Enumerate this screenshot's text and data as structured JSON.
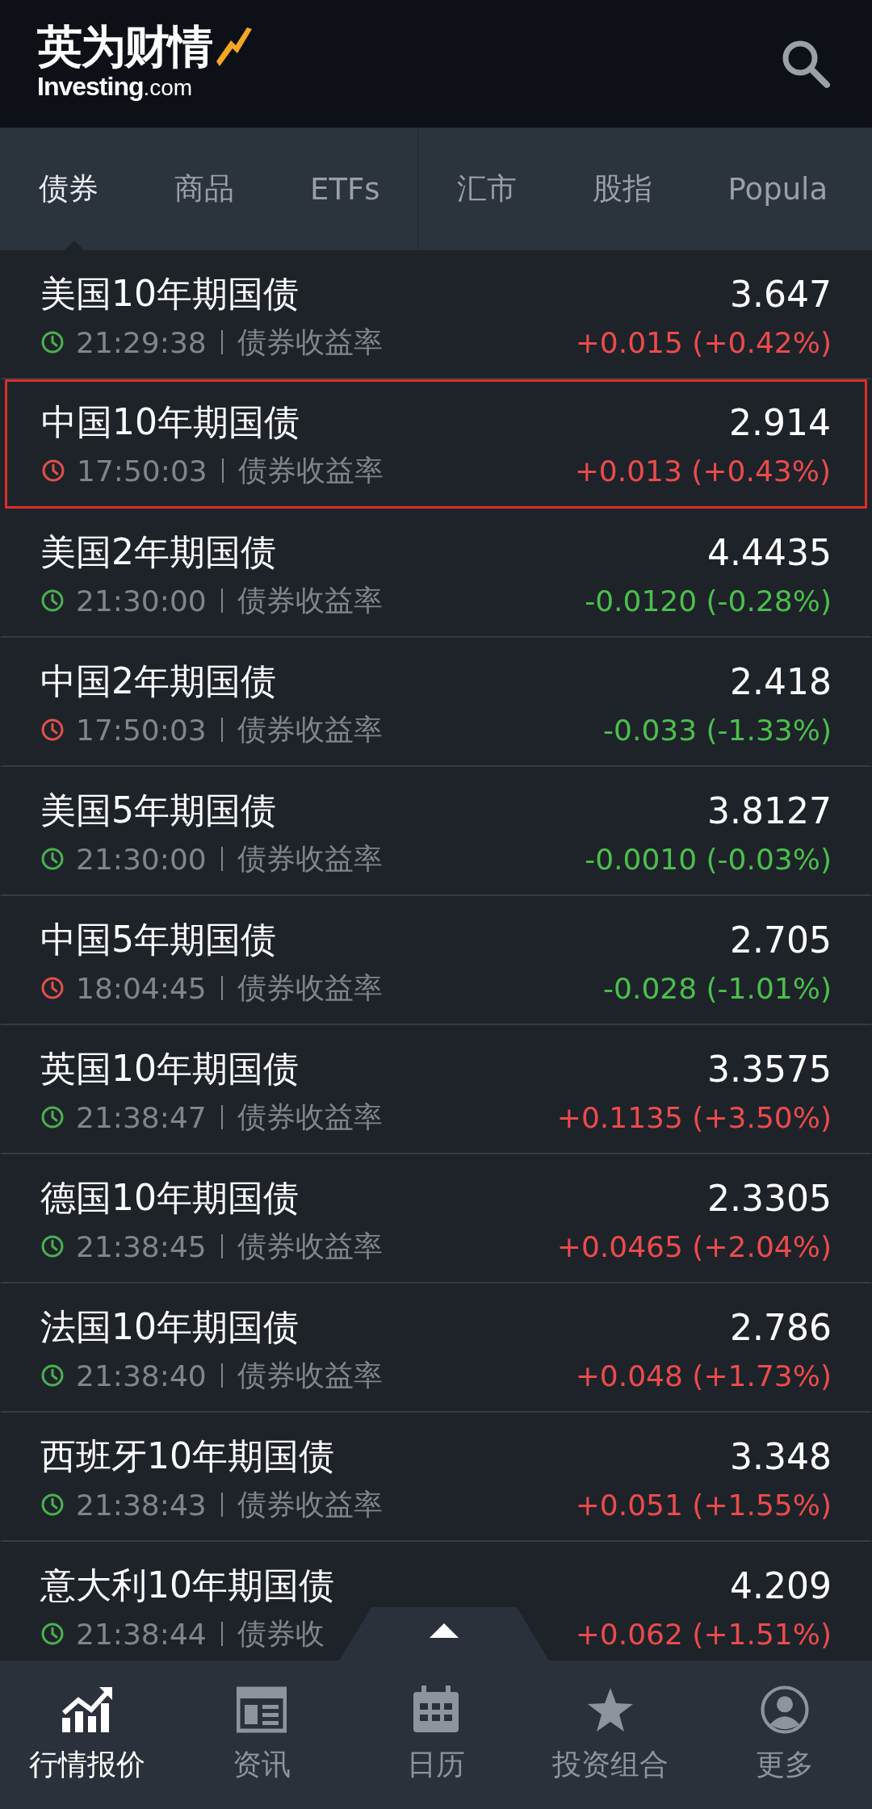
{
  "header": {
    "logo_title": "英为财情",
    "logo_brand": "Investing",
    "logo_suffix": ".com"
  },
  "tabs": [
    {
      "label": "债券",
      "selected": true
    },
    {
      "label": "商品",
      "selected": false
    },
    {
      "label": "ETFs",
      "selected": false
    },
    {
      "label": "汇市",
      "selected": false
    },
    {
      "label": "股指",
      "selected": false
    },
    {
      "label": "Popula",
      "selected": false
    }
  ],
  "rows": [
    {
      "name": "美国10年期国债",
      "time": "21:29:38",
      "type": "债券收益率",
      "price": "3.647",
      "change": "+0.015 (+0.42%)",
      "rising": true,
      "market_open": true,
      "highlighted": false
    },
    {
      "name": "中国10年期国债",
      "time": "17:50:03",
      "type": "债券收益率",
      "price": "2.914",
      "change": "+0.013 (+0.43%)",
      "rising": true,
      "market_open": false,
      "highlighted": true
    },
    {
      "name": "美国2年期国债",
      "time": "21:30:00",
      "type": "债券收益率",
      "price": "4.4435",
      "change": "-0.0120 (-0.28%)",
      "rising": false,
      "market_open": true,
      "highlighted": false
    },
    {
      "name": "中国2年期国债",
      "time": "17:50:03",
      "type": "债券收益率",
      "price": "2.418",
      "change": "-0.033 (-1.33%)",
      "rising": false,
      "market_open": false,
      "highlighted": false
    },
    {
      "name": "美国5年期国债",
      "time": "21:30:00",
      "type": "债券收益率",
      "price": "3.8127",
      "change": "-0.0010 (-0.03%)",
      "rising": false,
      "market_open": true,
      "highlighted": false
    },
    {
      "name": "中国5年期国债",
      "time": "18:04:45",
      "type": "债券收益率",
      "price": "2.705",
      "change": "-0.028 (-1.01%)",
      "rising": false,
      "market_open": false,
      "highlighted": false
    },
    {
      "name": "英国10年期国债",
      "time": "21:38:47",
      "type": "债券收益率",
      "price": "3.3575",
      "change": "+0.1135 (+3.50%)",
      "rising": true,
      "market_open": true,
      "highlighted": false
    },
    {
      "name": "德国10年期国债",
      "time": "21:38:45",
      "type": "债券收益率",
      "price": "2.3305",
      "change": "+0.0465 (+2.04%)",
      "rising": true,
      "market_open": true,
      "highlighted": false
    },
    {
      "name": "法国10年期国债",
      "time": "21:38:40",
      "type": "债券收益率",
      "price": "2.786",
      "change": "+0.048 (+1.73%)",
      "rising": true,
      "market_open": true,
      "highlighted": false
    },
    {
      "name": "西班牙10年期国债",
      "time": "21:38:43",
      "type": "债券收益率",
      "price": "3.348",
      "change": "+0.051 (+1.55%)",
      "rising": true,
      "market_open": true,
      "highlighted": false
    },
    {
      "name": "意大利10年期国债",
      "time": "21:38:44",
      "type": "债券收",
      "price": "4.209",
      "change": "+0.062 (+1.51%)",
      "rising": true,
      "market_open": true,
      "highlighted": false
    }
  ],
  "bottom_nav": [
    {
      "label": "行情报价",
      "kind": "quotes",
      "selected": true
    },
    {
      "label": "资讯",
      "kind": "news",
      "selected": false
    },
    {
      "label": "日历",
      "kind": "calendar",
      "selected": false
    },
    {
      "label": "投资组合",
      "kind": "portfolio",
      "selected": false
    },
    {
      "label": "更多",
      "kind": "more",
      "selected": false
    }
  ]
}
